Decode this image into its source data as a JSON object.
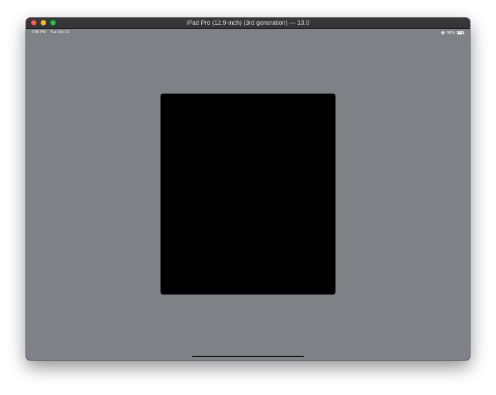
{
  "window": {
    "title": "iPad Pro (12.9-inch) (3rd generation) — 13.0"
  },
  "status_bar": {
    "time": "7:55 PM",
    "date": "Tue Oct 15",
    "battery_percent_label": "90%",
    "battery_level": 0.9,
    "wifi_icon": "wifi-icon",
    "battery_icon": "battery-icon"
  },
  "colors": {
    "screen_background": "#7e8286",
    "content_panel": "#000000",
    "close": "#fe5f57",
    "minimize": "#febc2e",
    "zoom": "#28c840"
  }
}
